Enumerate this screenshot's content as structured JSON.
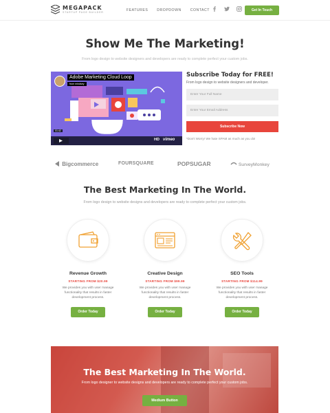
{
  "brand": {
    "name": "MEGAPACK",
    "tagline": "STARTUP PAGE BUILDER"
  },
  "nav": {
    "items": [
      "FEATURES",
      "DROPDOWN",
      "CONTACT"
    ]
  },
  "social": [
    "facebook-icon",
    "twitter-icon",
    "instagram-icon"
  ],
  "header_button": "Get In Touch",
  "hero": {
    "title": "Show Me The Marketing!",
    "subtitle": "From logo design to website designers and developers are ready to complete perfect your custom jobs."
  },
  "video": {
    "title": "Adobe Marketing Cloud Loop",
    "from": "from mindsey",
    "hd": "HD",
    "provider": "vimeo",
    "time": "01:42"
  },
  "subscribe": {
    "title": "Subscribe Today for FREE!",
    "desc": "From logo design to website designers and developer.",
    "name_placeholder": "Enter Your Full Name",
    "email_placeholder": "Enter Your Email Address",
    "button": "Subscribe Now",
    "note": "*Don't Worry! We hate SPAM as much as you do!"
  },
  "brands": [
    "Bigcommerce",
    "FOURSQUARE",
    "POPSUGAR",
    "SurveyMonkey"
  ],
  "section": {
    "title": "The Best Marketing In The World.",
    "subtitle": "From logo design to website designs and developers are ready to complete perfect your custom jobs."
  },
  "features": [
    {
      "title": "Revenue Growth",
      "price": "STARTING FROM $20.99",
      "desc": "We provides you with user manage functionality that results in faster development process.",
      "button": "Order Today",
      "icon": "wallet-icon"
    },
    {
      "title": "Creative Design",
      "price": "STARTING FROM $99.99",
      "desc": "We provides you with user manage functionality that results in faster development process.",
      "button": "Order Today",
      "icon": "browser-window-icon"
    },
    {
      "title": "SEO Tools",
      "price": "STARTING FROM $114.99",
      "desc": "We provides you with user manage functionality that results in faster development process.",
      "button": "Order Today",
      "icon": "tools-icon"
    }
  ],
  "banner": {
    "title": "The Best Marketing In The World.",
    "subtitle": "From logo designer to website designs and developers are ready to complete perfect your custom jobs.",
    "button": "Medium Button"
  },
  "colors": {
    "green": "#76b041",
    "red": "#e8453c",
    "orange": "#f0a030",
    "video_bg": "#7c68e0"
  }
}
